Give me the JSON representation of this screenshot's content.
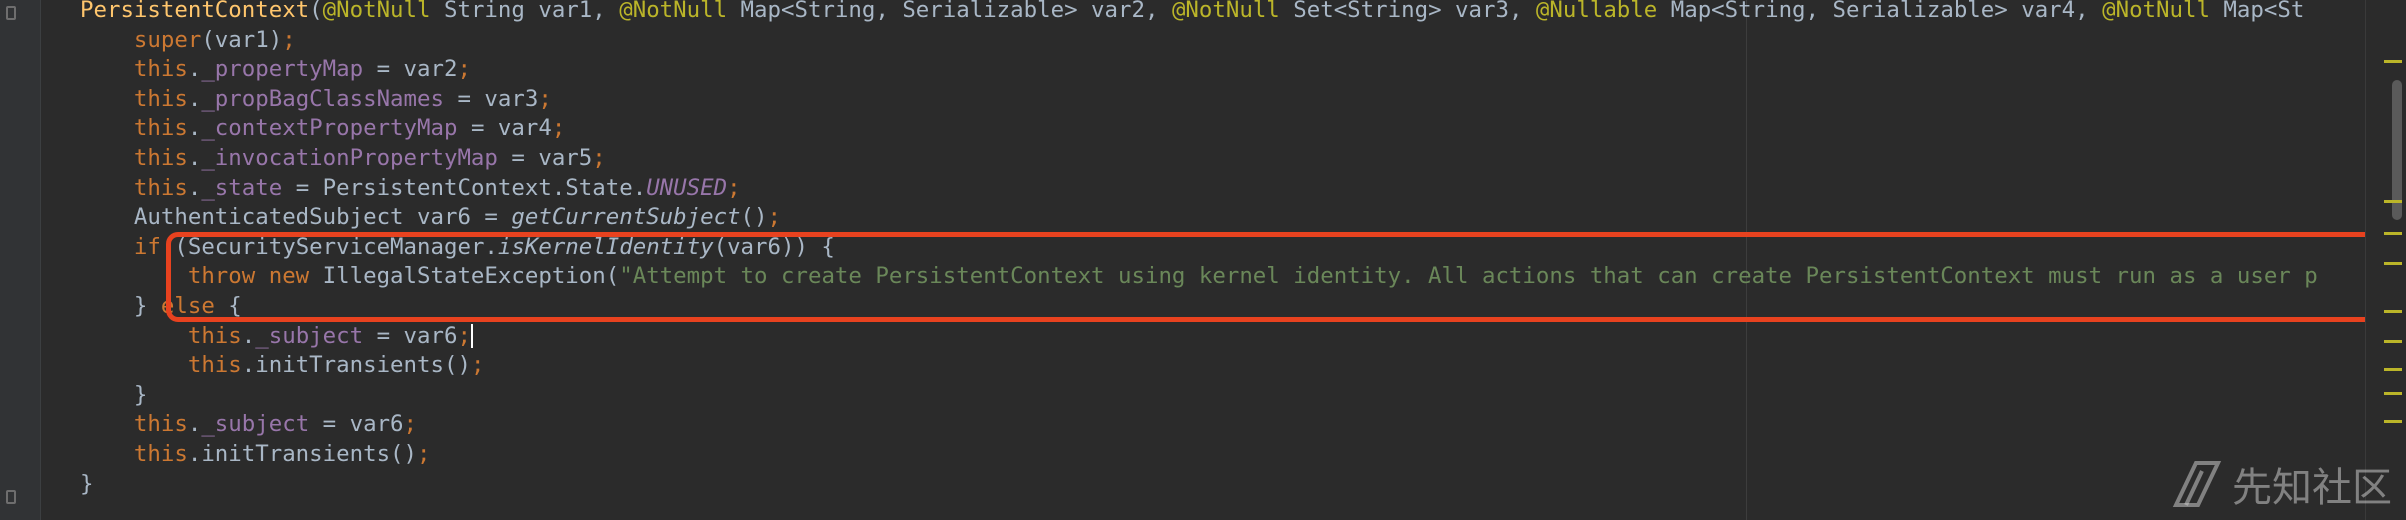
{
  "editor": {
    "lines": [
      [
        {
          "t": "PersistentContext",
          "c": "method"
        },
        {
          "t": "("
        },
        {
          "t": "@NotNull",
          "c": "ann"
        },
        {
          "t": " String var1, "
        },
        {
          "t": "@NotNull",
          "c": "ann"
        },
        {
          "t": " Map<String, Serializable> var2, "
        },
        {
          "t": "@NotNull",
          "c": "ann"
        },
        {
          "t": " Set<String> var3, "
        },
        {
          "t": "@Nullable",
          "c": "ann"
        },
        {
          "t": " Map<String, Serializable> var4, "
        },
        {
          "t": "@NotNull",
          "c": "ann"
        },
        {
          "t": " Map<St"
        }
      ],
      [
        {
          "t": "    "
        },
        {
          "t": "super",
          "c": "kw"
        },
        {
          "t": "(var1)"
        },
        {
          "t": ";",
          "c": "kw"
        }
      ],
      [
        {
          "t": "    "
        },
        {
          "t": "this",
          "c": "kw"
        },
        {
          "t": "."
        },
        {
          "t": "_propertyMap",
          "c": "field"
        },
        {
          "t": " = var2"
        },
        {
          "t": ";",
          "c": "kw"
        }
      ],
      [
        {
          "t": "    "
        },
        {
          "t": "this",
          "c": "kw"
        },
        {
          "t": "."
        },
        {
          "t": "_propBagClassNames",
          "c": "field"
        },
        {
          "t": " = var3"
        },
        {
          "t": ";",
          "c": "kw"
        }
      ],
      [
        {
          "t": "    "
        },
        {
          "t": "this",
          "c": "kw"
        },
        {
          "t": "."
        },
        {
          "t": "_contextPropertyMap",
          "c": "field"
        },
        {
          "t": " = var4"
        },
        {
          "t": ";",
          "c": "kw"
        }
      ],
      [
        {
          "t": "    "
        },
        {
          "t": "this",
          "c": "kw"
        },
        {
          "t": "."
        },
        {
          "t": "_invocationPropertyMap",
          "c": "field"
        },
        {
          "t": " = var5"
        },
        {
          "t": ";",
          "c": "kw"
        }
      ],
      [
        {
          "t": "    "
        },
        {
          "t": "this",
          "c": "kw"
        },
        {
          "t": "."
        },
        {
          "t": "_state",
          "c": "field"
        },
        {
          "t": " = PersistentContext.State."
        },
        {
          "t": "UNUSED",
          "c": "static"
        },
        {
          "t": ";",
          "c": "kw"
        }
      ],
      [
        {
          "t": "    AuthenticatedSubject var6 = "
        },
        {
          "t": "getCurrentSubject",
          "c": "italic"
        },
        {
          "t": "()"
        },
        {
          "t": ";",
          "c": "kw"
        }
      ],
      [
        {
          "t": "    "
        },
        {
          "t": "if",
          "c": "kw"
        },
        {
          "t": " (SecurityServiceManager."
        },
        {
          "t": "isKernelIdentity",
          "c": "italic"
        },
        {
          "t": "(var6)) {"
        }
      ],
      [
        {
          "t": "        "
        },
        {
          "t": "throw new",
          "c": "kw"
        },
        {
          "t": " IllegalStateException("
        },
        {
          "t": "\"Attempt to create PersistentContext using kernel identity. All actions that can create PersistentContext must run as a user p",
          "c": "str"
        }
      ],
      [
        {
          "t": "    } "
        },
        {
          "t": "else",
          "c": "kw"
        },
        {
          "t": " {"
        }
      ],
      [
        {
          "t": "        "
        },
        {
          "t": "this",
          "c": "kw"
        },
        {
          "t": "."
        },
        {
          "t": "_subject",
          "c": "field"
        },
        {
          "t": " = var6"
        },
        {
          "t": ";",
          "c": "kw"
        },
        {
          "t": "",
          "caret": true
        }
      ],
      [
        {
          "t": "        "
        },
        {
          "t": "this",
          "c": "kw"
        },
        {
          "t": ".initTransients()"
        },
        {
          "t": ";",
          "c": "kw"
        }
      ],
      [
        {
          "t": "    }"
        }
      ],
      [
        {
          "t": "    "
        },
        {
          "t": "this",
          "c": "kw"
        },
        {
          "t": "."
        },
        {
          "t": "_subject",
          "c": "field"
        },
        {
          "t": " = var6"
        },
        {
          "t": ";",
          "c": "kw"
        }
      ],
      [
        {
          "t": "    "
        },
        {
          "t": "this",
          "c": "kw"
        },
        {
          "t": ".initTransients()"
        },
        {
          "t": ";",
          "c": "kw"
        }
      ],
      [
        {
          "t": "}"
        }
      ]
    ]
  },
  "watermark": {
    "icon": "xianzhi-logo-icon",
    "text": "先知社区"
  },
  "colors": {
    "background": "#2b2b2b",
    "highlight_border": "#e8421f",
    "keyword": "#cc7832",
    "annotation": "#bbb529",
    "field": "#9876aa",
    "string": "#6a8759",
    "method": "#ffc66d",
    "plain": "#a9b7c6"
  }
}
